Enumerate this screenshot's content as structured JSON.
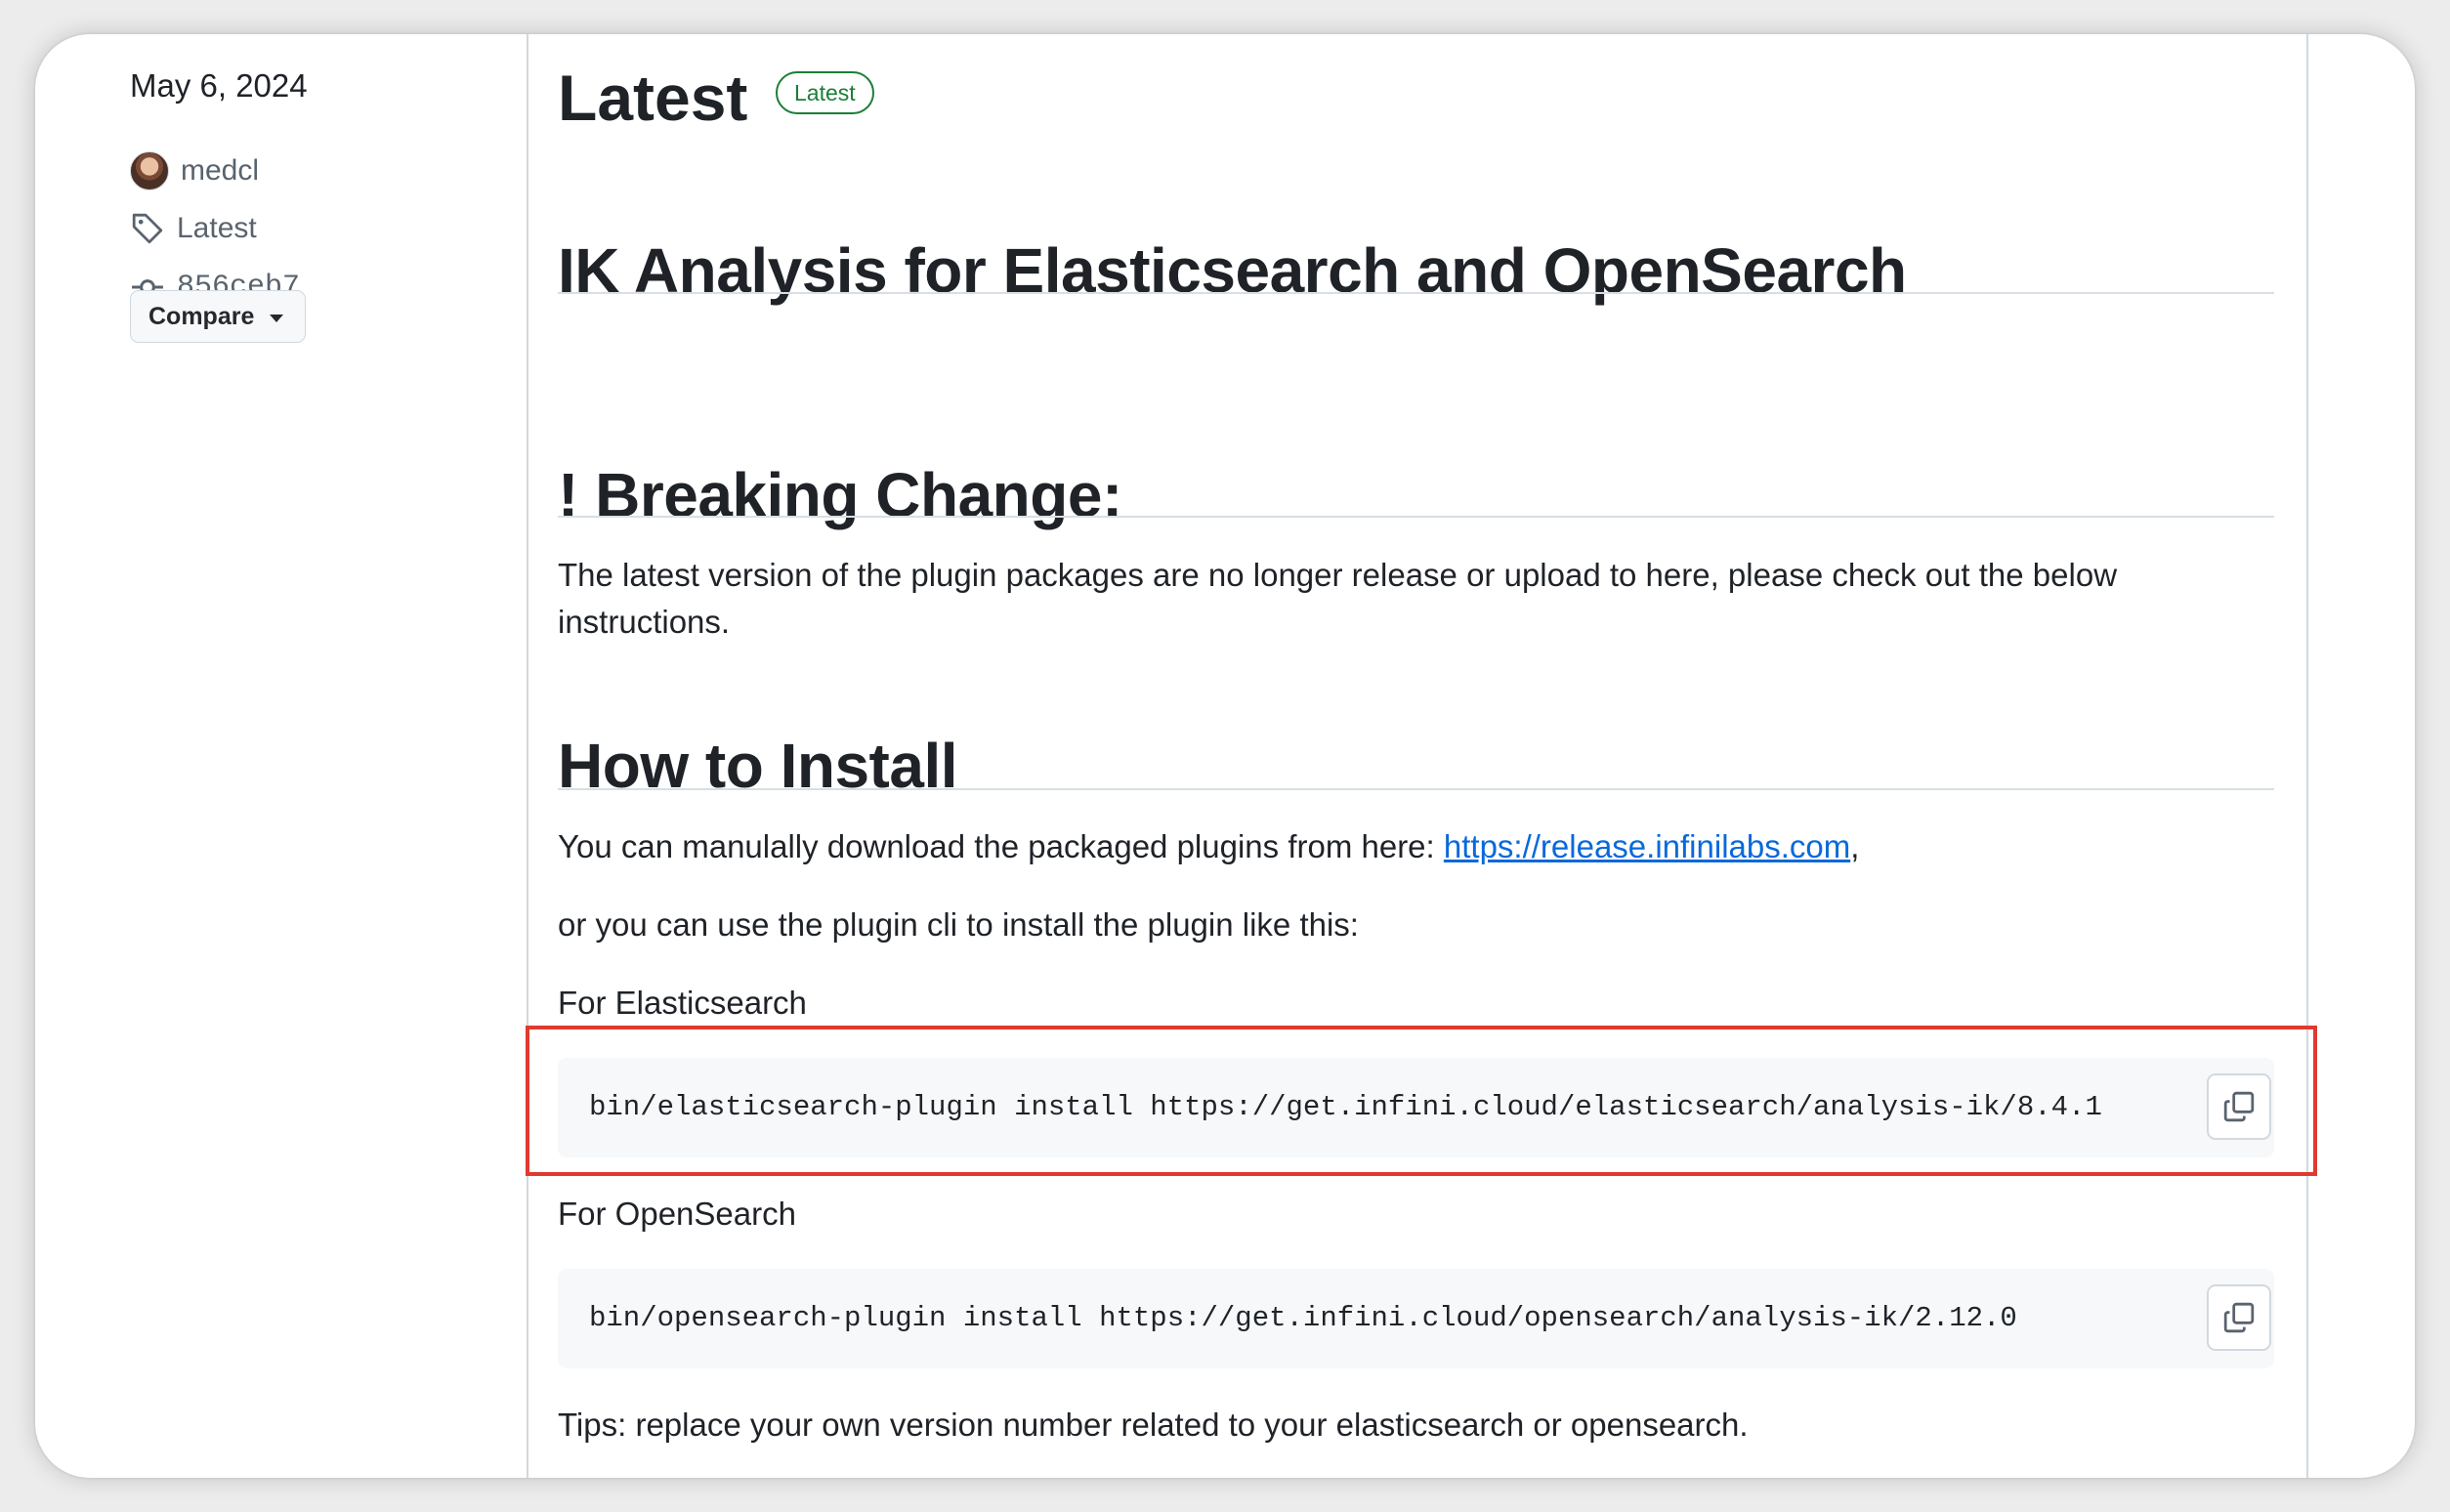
{
  "sidebar": {
    "date": "May 6, 2024",
    "author": "medcl",
    "tag": "Latest",
    "commit": "856ceb7",
    "compare_label": "Compare"
  },
  "release": {
    "title": "Latest",
    "badge": "Latest"
  },
  "body": {
    "heading_main": "IK Analysis for Elasticsearch and OpenSearch",
    "heading_breaking": "! Breaking Change:",
    "breaking_text": "The latest version of the plugin packages are no longer release or upload to here, please check out the below instructions.",
    "heading_install": "How to Install",
    "download_text": "You can manulally download the packaged plugins from here: ",
    "download_link": "https://release.infinilabs.com",
    "download_suffix": ",",
    "cli_text": "or you can use the plugin cli to install the plugin like this:",
    "es_label": "For Elasticsearch",
    "es_command": "bin/elasticsearch-plugin install https://get.infini.cloud/elasticsearch/analysis-ik/8.4.1",
    "os_label": "For OpenSearch",
    "os_command": "bin/opensearch-plugin install https://get.infini.cloud/opensearch/analysis-ik/2.12.0",
    "tips": "Tips: replace your own version number related to your elasticsearch or opensearch."
  },
  "colors": {
    "link": "#0969da",
    "badge_green": "#1a7f37",
    "highlight_red": "#e03a30",
    "code_bg": "#f6f8fa"
  },
  "icons": [
    "tag-icon",
    "commit-icon",
    "chevron-down-icon",
    "copy-icon"
  ]
}
